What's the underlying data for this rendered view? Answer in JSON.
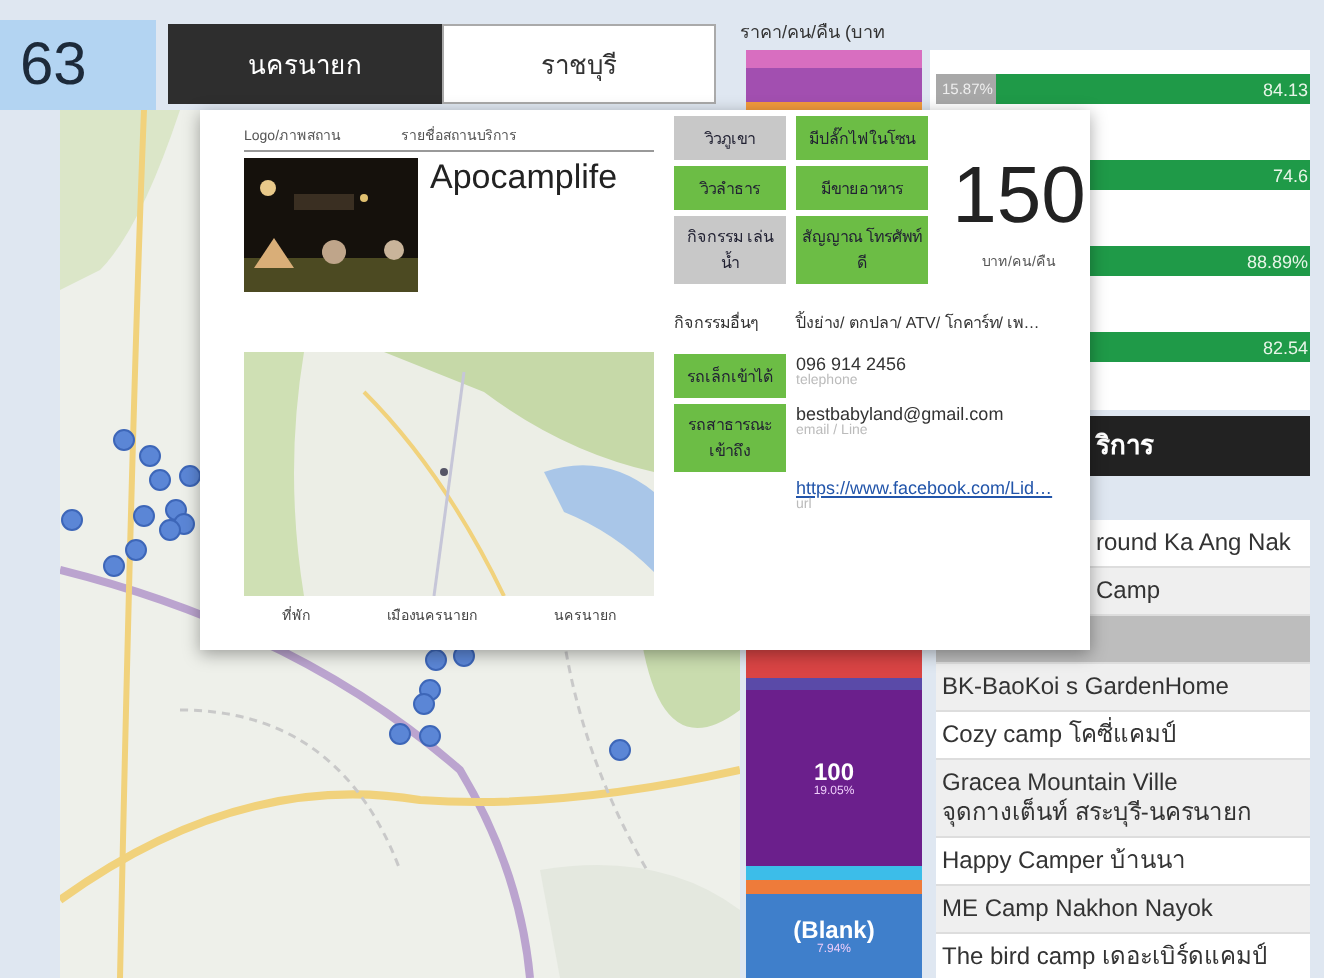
{
  "counter": {
    "value": "63"
  },
  "tabs": [
    {
      "label": "นครนายก",
      "selected": true
    },
    {
      "label": "ราชบุรี",
      "selected": false
    }
  ],
  "price_stack": {
    "title": "ราคา/คน/คืน (บาท",
    "segments": [
      {
        "color": "#d86ec0"
      },
      {
        "color": "#a24fb0"
      },
      {
        "color": "#f39a3c"
      },
      {
        "color": "#d94444"
      },
      {
        "color": "#5a4aa8"
      },
      {
        "color": "#6b1f8c",
        "label": "100",
        "percent": "19.05%"
      },
      {
        "color": "#3cbde9"
      },
      {
        "color": "#ee7b3a"
      },
      {
        "color": "#3f7fcb",
        "label": "(Blank)",
        "percent": "7.94%"
      }
    ]
  },
  "share_rows": [
    {
      "level": 0.8413,
      "fill_label": "84.13",
      "rest_label": "15.87%"
    },
    {
      "level": 0.746,
      "fill_label": "74.6"
    },
    {
      "level": 0.8889,
      "fill_label": "88.89%"
    },
    {
      "level": 0.8254,
      "fill_label": "82.54"
    }
  ],
  "table": {
    "header": "ริการ",
    "rows": [
      {
        "name": "round Ka Ang Nak",
        "covered": true,
        "selected": false
      },
      {
        "name": "Camp",
        "covered": true,
        "selected": false
      },
      {
        "covered": false,
        "selected": true
      },
      {
        "name": "BK-BaoKoi s GardenHome",
        "covered": false,
        "selected": false
      },
      {
        "name": "Cozy camp โคซี่แคมป์",
        "covered": false,
        "selected": false
      },
      {
        "name": "Gracea Mountain Ville\nจุดกางเต็นท์ สระบุรี-นครนายก",
        "covered": false,
        "selected": false
      },
      {
        "name": "Happy Camper บ้านนา",
        "covered": false,
        "selected": false
      },
      {
        "name": "ME Camp Nakhon Nayok",
        "covered": false,
        "selected": false
      },
      {
        "name": "The bird camp เดอะเบิร์ดแคมป์",
        "covered": false,
        "selected": false
      }
    ]
  },
  "popup": {
    "headers": [
      "Logo/ภาพสถาน",
      "รายชื่อสถานบริการ"
    ],
    "name": "Apocamplife",
    "features": [
      {
        "label": "วิวภูเขา",
        "on": false
      },
      {
        "label": "มีปลั๊กไฟในโซน",
        "on": true
      },
      {
        "label": "วิวลำธาร",
        "on": true
      },
      {
        "label": "มีขายอาหาร",
        "on": true
      },
      {
        "label": "กิจกรรม เล่นน้ำ",
        "on": false
      },
      {
        "label": "สัญญาณ โทรศัพท์ดี",
        "on": true
      }
    ],
    "activities": {
      "label": "กิจกรรมอื่นๆ",
      "value": "ปิ้งย่าง/ ตกปลา/ ATV/ โกคาร์ท/ เพ…"
    },
    "access": [
      {
        "label": "รถเล็กเข้าได้",
        "on": true
      },
      {
        "label": "รถสาธารณะ เข้าถึง",
        "on": true
      }
    ],
    "contacts": [
      {
        "kind": "text",
        "value": "096 914 2456",
        "caption": "telephone"
      },
      {
        "kind": "text",
        "value": "bestbabyland@gmail.com",
        "caption": "email / Line"
      },
      {
        "kind": "link",
        "value": "https://www.facebook.com/Lid…",
        "caption": "url"
      }
    ],
    "price": {
      "value": "150",
      "unit": "บาท/คน/คืน"
    },
    "location": [
      "ที่พัก",
      "เมืองนครนายก",
      "นครนายก"
    ]
  }
}
